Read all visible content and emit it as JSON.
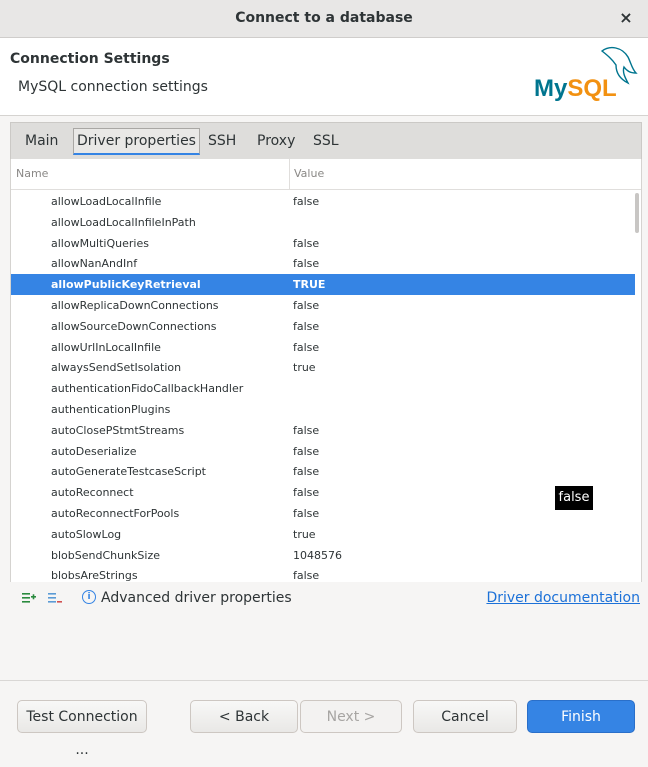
{
  "window": {
    "title": "Connect to a database",
    "close_glyph": "×"
  },
  "header": {
    "title": "Connection Settings",
    "subtitle": "MySQL connection settings",
    "logo_text": "MySQL"
  },
  "tabs": [
    {
      "label": "Main"
    },
    {
      "label": "Driver properties",
      "active": true
    },
    {
      "label": "SSH"
    },
    {
      "label": "Proxy"
    },
    {
      "label": "SSL"
    }
  ],
  "table": {
    "columns": [
      "Name",
      "Value"
    ],
    "rows": [
      {
        "name": "allowLoadLocalInfile",
        "value": "false"
      },
      {
        "name": "allowLoadLocalInfileInPath",
        "value": ""
      },
      {
        "name": "allowMultiQueries",
        "value": "false"
      },
      {
        "name": "allowNanAndInf",
        "value": "false"
      },
      {
        "name": "allowPublicKeyRetrieval",
        "value": "TRUE",
        "selected": true
      },
      {
        "name": "allowReplicaDownConnections",
        "value": "false"
      },
      {
        "name": "allowSourceDownConnections",
        "value": "false"
      },
      {
        "name": "allowUrlInLocalInfile",
        "value": "false"
      },
      {
        "name": "alwaysSendSetIsolation",
        "value": "true"
      },
      {
        "name": "authenticationFidoCallbackHandler",
        "value": ""
      },
      {
        "name": "authenticationPlugins",
        "value": ""
      },
      {
        "name": "autoClosePStmtStreams",
        "value": "false"
      },
      {
        "name": "autoDeserialize",
        "value": "false"
      },
      {
        "name": "autoGenerateTestcaseScript",
        "value": "false"
      },
      {
        "name": "autoReconnect",
        "value": "false"
      },
      {
        "name": "autoReconnectForPools",
        "value": "false"
      },
      {
        "name": "autoSlowLog",
        "value": "true"
      },
      {
        "name": "blobSendChunkSize",
        "value": "1048576"
      },
      {
        "name": "blobsAreStrings",
        "value": "false"
      }
    ]
  },
  "editor_popup": {
    "value": "false"
  },
  "toolbar": {
    "add_icon": "add-property-icon",
    "remove_icon": "remove-property-icon",
    "info_icon": "info-icon",
    "advanced_label": "Advanced driver properties",
    "doc_link": "Driver documentation"
  },
  "footer": {
    "test_connection": "Test Connection ...",
    "back": "< Back",
    "next": "Next >",
    "cancel": "Cancel",
    "finish": "Finish"
  },
  "colors": {
    "accent": "#3584e4",
    "link": "#1c71d8",
    "logo_blue": "#00758f",
    "logo_orange": "#f29111"
  }
}
